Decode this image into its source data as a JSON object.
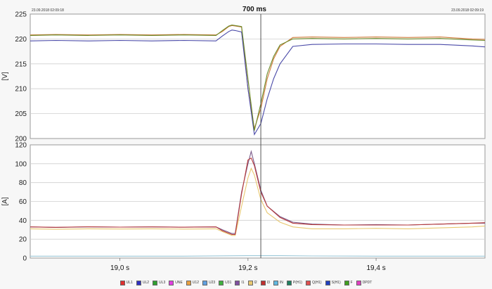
{
  "header": {
    "start_timestamp": "23.09.2018 02:09:18",
    "end_timestamp": "23.09.2018 02:09:19",
    "window_label": "700 ms"
  },
  "chart_data": [
    {
      "type": "line",
      "panel": "voltage",
      "ylabel": "[V]",
      "ylim": [
        200,
        225
      ],
      "yticks": [
        200,
        205,
        210,
        215,
        220,
        225
      ],
      "xlim": [
        18.86,
        19.57
      ],
      "grid": true,
      "series": [
        {
          "name": "UL1",
          "color": "#d07a3a",
          "x": [
            18.86,
            18.9,
            18.95,
            19.0,
            19.05,
            19.1,
            19.15,
            19.16,
            19.17,
            19.175,
            19.18,
            19.19,
            19.2,
            19.21,
            19.22,
            19.23,
            19.24,
            19.25,
            19.27,
            19.3,
            19.35,
            19.4,
            19.45,
            19.5,
            19.55,
            19.57
          ],
          "y": [
            220.8,
            220.9,
            220.8,
            220.9,
            220.8,
            220.9,
            220.8,
            221.5,
            222.5,
            222.7,
            222.6,
            222.4,
            210,
            202,
            206,
            212,
            216,
            218.5,
            220.3,
            220.4,
            220.3,
            220.4,
            220.3,
            220.4,
            220.0,
            219.9
          ]
        },
        {
          "name": "UL2",
          "color": "#4a4aa8",
          "x": [
            18.86,
            18.9,
            18.95,
            19.0,
            19.05,
            19.1,
            19.15,
            19.16,
            19.17,
            19.175,
            19.18,
            19.19,
            19.2,
            19.21,
            19.22,
            19.23,
            19.24,
            19.25,
            19.27,
            19.3,
            19.35,
            19.4,
            19.45,
            19.5,
            19.55,
            19.57
          ],
          "y": [
            219.6,
            219.7,
            219.6,
            219.7,
            219.6,
            219.7,
            219.6,
            220.6,
            221.5,
            221.8,
            221.7,
            221.4,
            210,
            200.8,
            203,
            208,
            212,
            215,
            218.5,
            218.9,
            219.0,
            219.0,
            218.9,
            218.9,
            218.6,
            218.4
          ]
        },
        {
          "name": "UL3",
          "color": "#6a8a2a",
          "x": [
            18.86,
            18.9,
            18.95,
            19.0,
            19.05,
            19.1,
            19.15,
            19.16,
            19.17,
            19.175,
            19.18,
            19.19,
            19.2,
            19.21,
            19.22,
            19.23,
            19.24,
            19.25,
            19.27,
            19.3,
            19.35,
            19.4,
            19.45,
            19.5,
            19.55,
            19.57
          ],
          "y": [
            220.7,
            220.8,
            220.7,
            220.8,
            220.7,
            220.8,
            220.7,
            221.7,
            222.6,
            222.8,
            222.7,
            222.5,
            212,
            201.6,
            207,
            213,
            216.5,
            218.8,
            220.0,
            220.1,
            220.0,
            220.1,
            220.0,
            220.1,
            219.8,
            219.7
          ]
        }
      ]
    },
    {
      "type": "line",
      "panel": "current",
      "ylabel": "[A]",
      "ylim": [
        0,
        120
      ],
      "yticks": [
        0,
        20,
        40,
        60,
        80,
        100,
        120
      ],
      "xlim": [
        18.86,
        19.57
      ],
      "xticks": [
        {
          "value": 19.0,
          "label": "19,0 s"
        },
        {
          "value": 19.2,
          "label": "19,2 s"
        },
        {
          "value": 19.4,
          "label": "19,4 s"
        }
      ],
      "grid": true,
      "series": [
        {
          "name": "I1",
          "color": "#7a5a8a",
          "x": [
            18.86,
            18.9,
            18.95,
            19.0,
            19.05,
            19.1,
            19.15,
            19.16,
            19.175,
            19.18,
            19.19,
            19.2,
            19.205,
            19.21,
            19.22,
            19.23,
            19.25,
            19.27,
            19.3,
            19.35,
            19.4,
            19.45,
            19.5,
            19.55,
            19.57
          ],
          "y": [
            33,
            32.5,
            33,
            32.8,
            33,
            32.7,
            33,
            30,
            26,
            26,
            70,
            100,
            113,
            100,
            72,
            55,
            44,
            38,
            36,
            35,
            35.5,
            35,
            36,
            37,
            37
          ]
        },
        {
          "name": "I2",
          "color": "#e8c870",
          "x": [
            18.86,
            18.9,
            18.95,
            19.0,
            19.05,
            19.1,
            19.15,
            19.16,
            19.175,
            19.18,
            19.19,
            19.2,
            19.205,
            19.21,
            19.22,
            19.23,
            19.25,
            19.27,
            19.3,
            19.35,
            19.4,
            19.45,
            19.5,
            19.55,
            19.57
          ],
          "y": [
            31,
            30.5,
            31,
            30.8,
            31,
            30.7,
            31,
            28,
            24,
            24,
            55,
            85,
            95,
            88,
            62,
            48,
            38,
            33,
            31,
            31,
            31.5,
            31,
            32,
            33,
            34
          ]
        },
        {
          "name": "I3",
          "color": "#b83a3a",
          "x": [
            18.86,
            18.9,
            18.95,
            19.0,
            19.05,
            19.1,
            19.15,
            19.16,
            19.175,
            19.18,
            19.19,
            19.2,
            19.205,
            19.21,
            19.22,
            19.23,
            19.25,
            19.27,
            19.3,
            19.35,
            19.4,
            19.45,
            19.5,
            19.55,
            19.57
          ],
          "y": [
            33,
            32.6,
            33.2,
            32.8,
            33,
            32.7,
            33,
            29,
            25,
            25,
            68,
            104,
            106,
            98,
            70,
            55,
            43,
            37,
            35.5,
            35,
            35,
            35,
            36,
            37,
            37.5
          ]
        },
        {
          "name": "IN",
          "color": "#9cc8d8",
          "x": [
            18.86,
            19.0,
            19.1,
            19.2,
            19.25,
            19.3,
            19.4,
            19.5,
            19.57
          ],
          "y": [
            2,
            2,
            2,
            2.5,
            2.5,
            2.2,
            2,
            2,
            2
          ]
        }
      ]
    }
  ],
  "cursor": {
    "x": 19.22
  },
  "legend": {
    "items": [
      {
        "label": "UL1",
        "color": "#e03030"
      },
      {
        "label": "UL2",
        "color": "#3030c0"
      },
      {
        "label": "UL3",
        "color": "#30a030"
      },
      {
        "label": "UNE",
        "color": "#e040e0"
      },
      {
        "label": "U12",
        "color": "#e8a040"
      },
      {
        "label": "U23",
        "color": "#60a0e0"
      },
      {
        "label": "U31",
        "color": "#40b040"
      },
      {
        "label": "I1",
        "color": "#8050a0"
      },
      {
        "label": "I2",
        "color": "#e8c870"
      },
      {
        "label": "I3",
        "color": "#c03030"
      },
      {
        "label": "IN",
        "color": "#60b8e0"
      },
      {
        "label": "P(H1)",
        "color": "#208060"
      },
      {
        "label": "Q(H1)",
        "color": "#e05050"
      },
      {
        "label": "S(H1)",
        "color": "#2040c0"
      },
      {
        "label": "F",
        "color": "#40a020"
      },
      {
        "label": "DPDT",
        "color": "#e040c0"
      }
    ]
  }
}
